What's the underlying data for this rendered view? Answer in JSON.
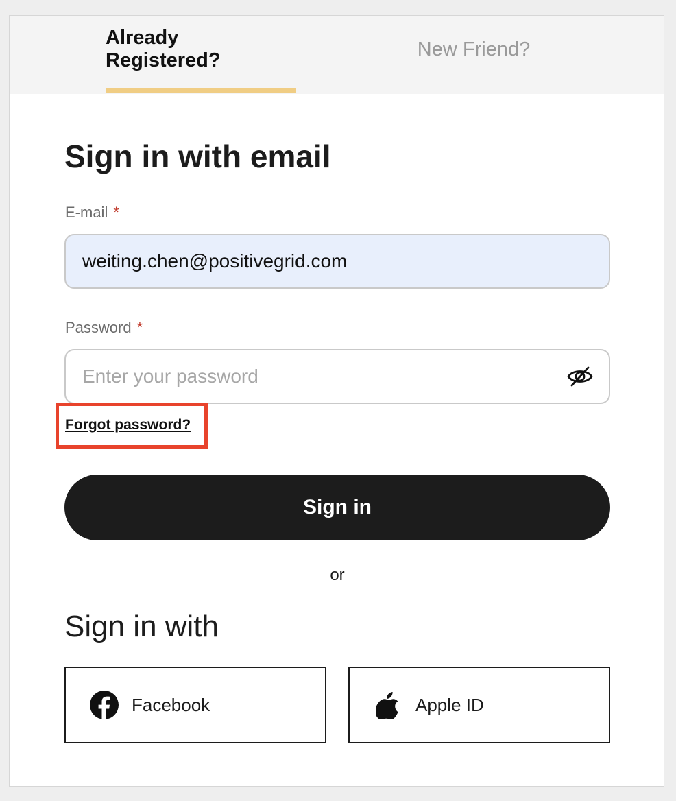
{
  "tabs": {
    "login_label": "Already Registered?",
    "register_label": "New Friend?"
  },
  "form": {
    "heading": "Sign in with email",
    "email_label": "E-mail",
    "email_required_mark": "*",
    "email_value": "weiting.chen@positivegrid.com",
    "password_label": "Password",
    "password_required_mark": "*",
    "password_placeholder": "Enter your password",
    "password_toggle_icon": "eye-slash-icon",
    "forgot_password_label": "Forgot password?",
    "signin_button_label": "Sign in"
  },
  "divider": {
    "text": "or"
  },
  "social": {
    "heading": "Sign in with",
    "buttons": [
      {
        "label": "Facebook",
        "icon": "facebook-icon"
      },
      {
        "label": "Apple ID",
        "icon": "apple-icon"
      }
    ]
  },
  "colors": {
    "tab_active_underline": "#f0cd84",
    "required_mark": "#c0392b",
    "highlight_box": "#e8432c",
    "primary_button": "#1c1c1c",
    "email_field_bg": "#e8effc"
  }
}
